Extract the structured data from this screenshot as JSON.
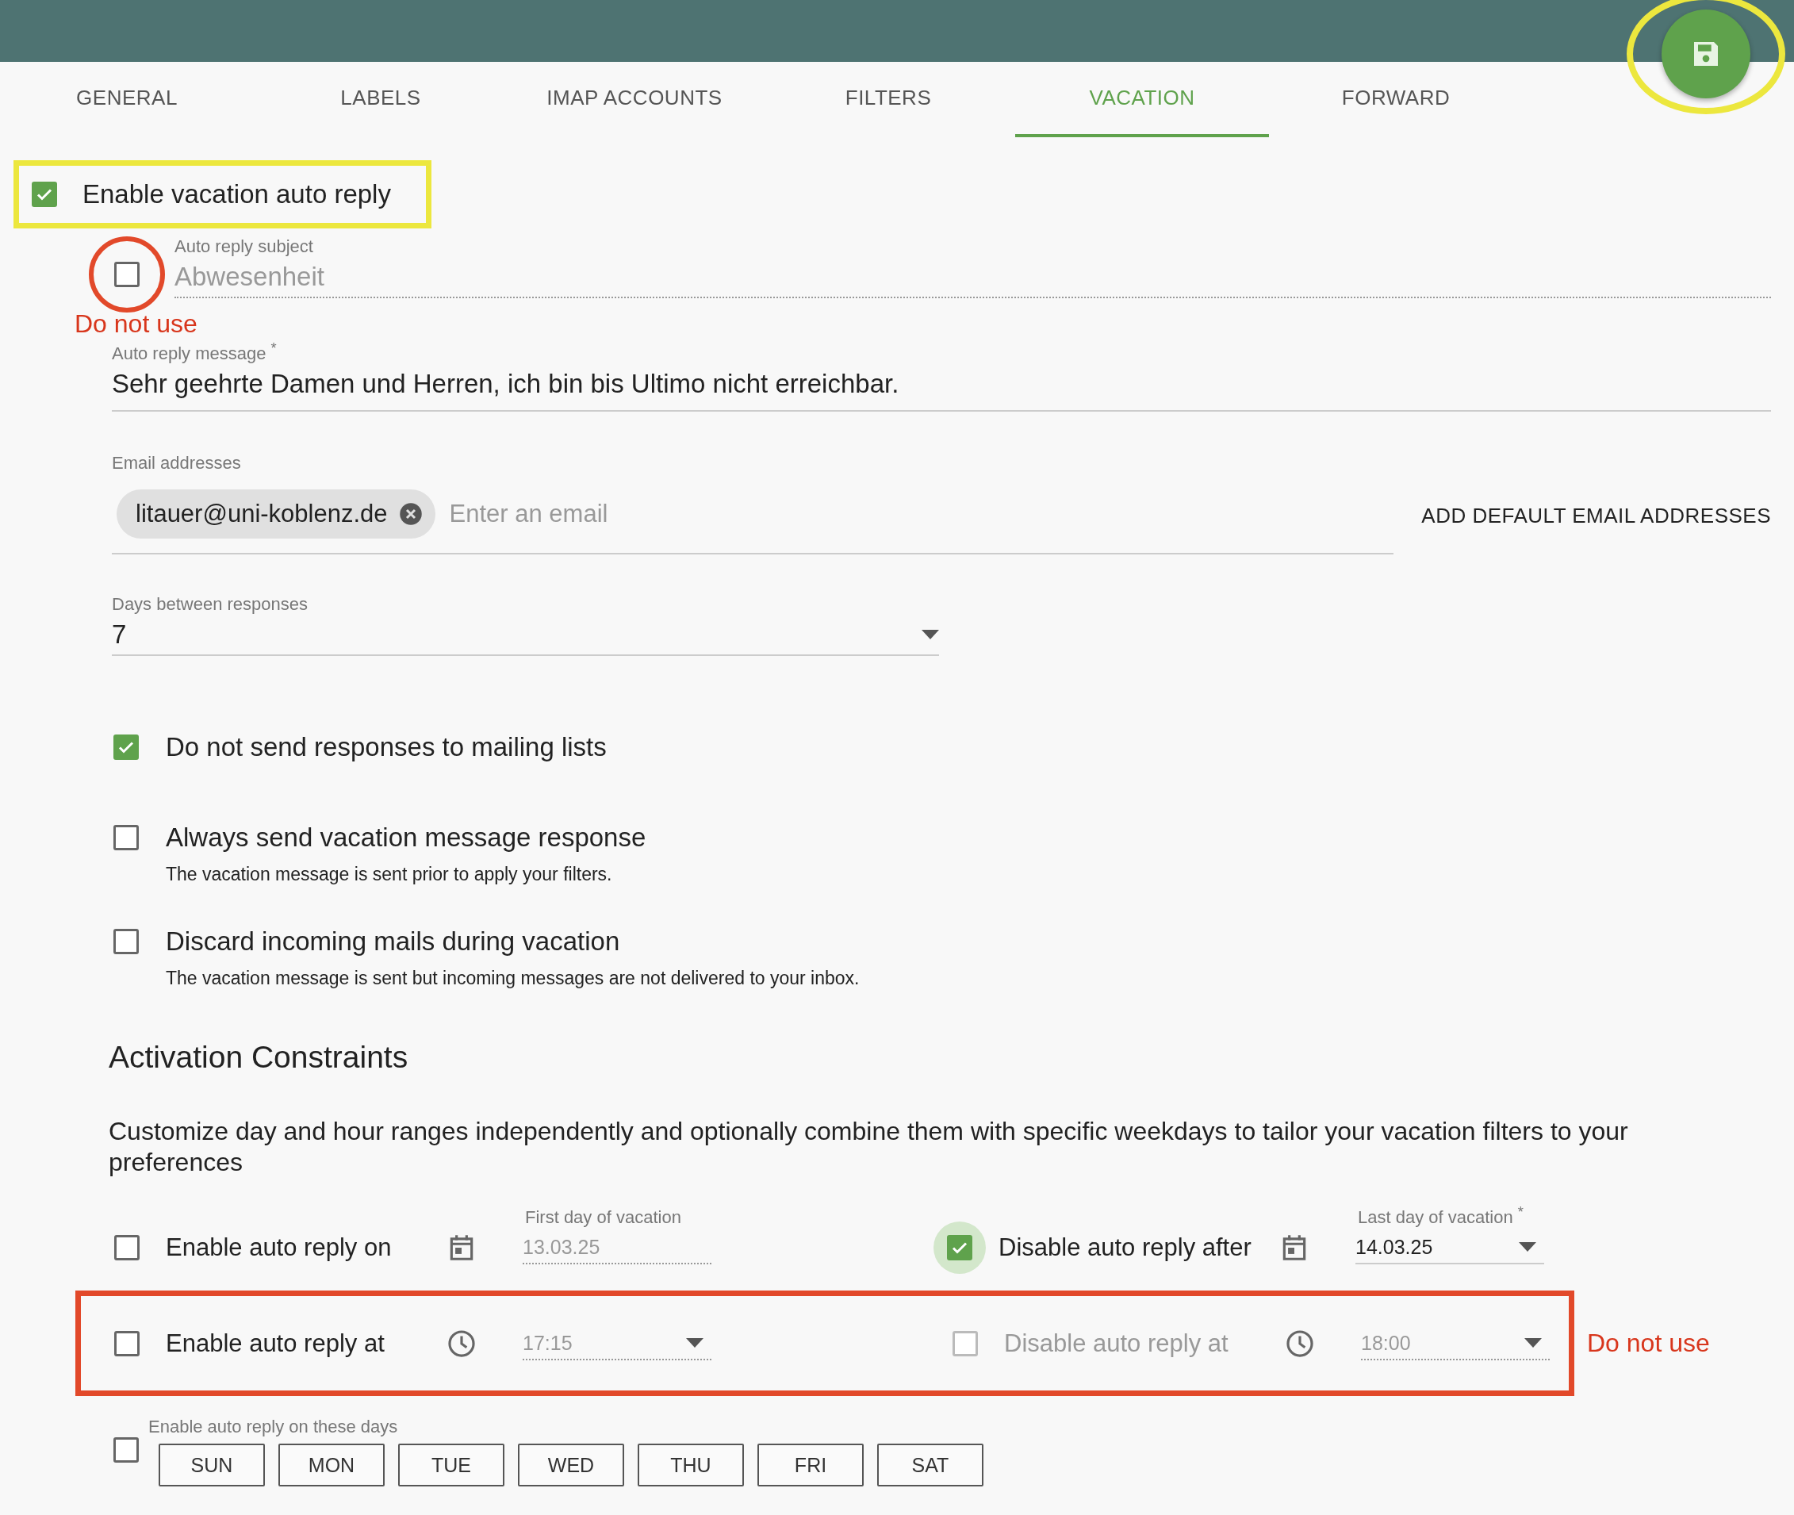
{
  "tabs": [
    {
      "label": "GENERAL",
      "selected": false
    },
    {
      "label": "LABELS",
      "selected": false
    },
    {
      "label": "IMAP ACCOUNTS",
      "selected": false
    },
    {
      "label": "FILTERS",
      "selected": false
    },
    {
      "label": "VACATION",
      "selected": true
    },
    {
      "label": "FORWARD",
      "selected": false
    }
  ],
  "enable_vacation": {
    "label": "Enable vacation auto reply",
    "checked": true
  },
  "subject": {
    "label": "Auto reply subject",
    "value": "Abwesenheit",
    "disabled": true,
    "checked": false
  },
  "annotation_notes": [
    "Do not use",
    "Do not use"
  ],
  "message": {
    "label": "Auto reply message $^{*}$",
    "value": "Sehr geehrte Damen und Herren, ich bin bis Ultimo nicht erreichbar."
  },
  "email": {
    "label": "Email addresses",
    "chips": [
      "litauer@uni-koblenz.de"
    ],
    "placeholder": "Enter an email",
    "action": "ADD DEFAULT EMAIL ADDRESSES"
  },
  "days_between": {
    "label": "Days between responses",
    "value": "7"
  },
  "options": [
    {
      "label": "Do not send responses to mailing lists",
      "checked": true
    },
    {
      "label": "Always send vacation message response",
      "checked": false,
      "hint": "The vacation message is sent prior to apply your filters."
    },
    {
      "label": "Discard incoming mails during vacation",
      "checked": false,
      "hint": "The vacation message is sent but incoming messages are not delivered to your inbox."
    }
  ],
  "activation": {
    "title": "Activation Constraints",
    "description": "Customize day and hour ranges independently and optionally combine them with specific weekdays to tailor your vacation filters to your preferences"
  },
  "date_constraints": [
    {
      "label": "Enable auto reply on",
      "checked": false,
      "focused": false,
      "disabled": false,
      "kind": "date",
      "field": {
        "label": "First day of vacation",
        "value": "13.03.25",
        "disabled": true,
        "dropdown": false
      }
    },
    {
      "label": "Disable auto reply after",
      "checked": true,
      "focused": true,
      "disabled": false,
      "kind": "date",
      "field": {
        "label": "Last day of vacation $^{*}$",
        "value": "14.03.25",
        "disabled": false,
        "dropdown": true
      }
    }
  ],
  "time_constraints": [
    {
      "label": "Enable auto reply at",
      "checked": false,
      "focused": false,
      "disabled": false,
      "kind": "time",
      "field": {
        "value": "17:15",
        "disabled": true,
        "dropdown": true
      }
    },
    {
      "label": "Disable auto reply at",
      "checked": false,
      "focused": false,
      "disabled": true,
      "kind": "time",
      "field": {
        "value": "18:00",
        "disabled": true,
        "dropdown": true
      }
    }
  ],
  "weekdays": {
    "label": "Enable auto reply on these days",
    "checked": false,
    "days": [
      "SUN",
      "MON",
      "TUE",
      "WED",
      "THU",
      "FRI",
      "SAT"
    ]
  }
}
